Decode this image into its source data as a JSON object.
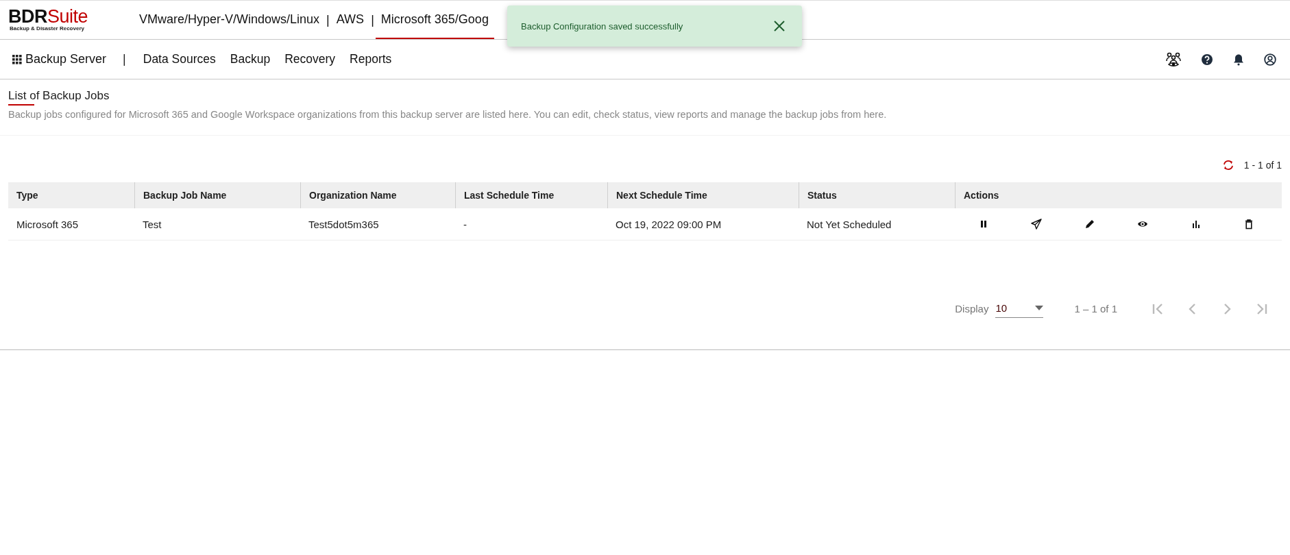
{
  "brand": {
    "name_dark": "BDR",
    "name_red": "Suite",
    "tagline": "Backup & Disaster Recovery"
  },
  "product_tabs": [
    {
      "label": "VMware/Hyper-V/Windows/Linux",
      "selected": false
    },
    {
      "label": "AWS",
      "selected": false
    },
    {
      "label": "Microsoft 365/Goog",
      "selected": true
    }
  ],
  "separator": "|",
  "toast": {
    "message": "Backup Configuration saved successfully"
  },
  "nav": {
    "server": "Backup Server",
    "separator": "|",
    "items": [
      "Data Sources",
      "Backup",
      "Recovery",
      "Reports"
    ]
  },
  "page": {
    "title": "List of Backup Jobs",
    "description": "Backup jobs configured for Microsoft 365 and Google Workspace organizations from this backup server are listed here. You can edit, check status, view reports and manage the backup jobs from here."
  },
  "table": {
    "count": "1 - 1 of 1",
    "columns": [
      "Type",
      "Backup Job Name",
      "Organization Name",
      "Last Schedule Time",
      "Next Schedule Time",
      "Status",
      "Actions"
    ],
    "rows": [
      {
        "cells": [
          "Microsoft 365",
          "Test",
          "Test5dot5m365",
          "-",
          "Oct 19, 2022 09:00 PM",
          "Not Yet Scheduled"
        ],
        "actions": [
          {
            "kind": "pause"
          },
          {
            "kind": "send"
          },
          {
            "kind": "edit"
          },
          {
            "kind": "view"
          },
          {
            "kind": "report"
          },
          {
            "kind": "delete"
          }
        ]
      }
    ]
  },
  "pagination": {
    "label": "Display",
    "page_size": "10",
    "range": "1 – 1 of 1"
  }
}
